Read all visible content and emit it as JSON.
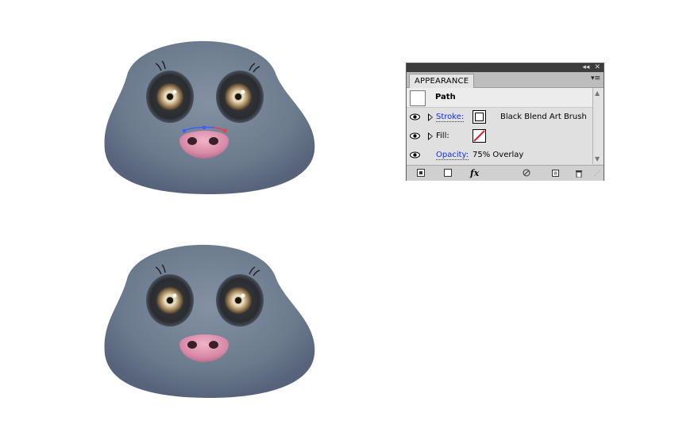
{
  "panel": {
    "tab_label": "APPEARANCE",
    "titlebar": {
      "collapse_glyph": "◂◂",
      "close_glyph": "✕"
    },
    "menu_glyph": "▾≡",
    "path_label": "Path",
    "rows": [
      {
        "label": "Stroke:",
        "value": "Black Blend Art Brush"
      },
      {
        "label": "Fill:",
        "value": ""
      },
      {
        "label": "Opacity:",
        "value": "75% Overlay"
      }
    ],
    "fx_label": "fx",
    "scroll_up": "▲",
    "scroll_down": "▼"
  },
  "colors": {
    "head": "#6b7a8d",
    "nose": "#d98aa8",
    "link": "#1a2fd1"
  },
  "icons": [
    "eye-icon",
    "triangle-icon",
    "fx-icon",
    "no-icon",
    "new-item-icon",
    "trash-icon"
  ]
}
